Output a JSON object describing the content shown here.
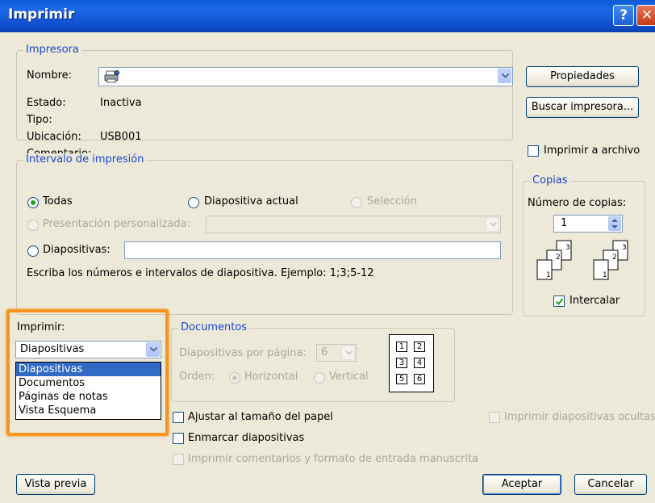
{
  "window": {
    "title": "Imprimir",
    "help_button": "?",
    "close_button": "✕"
  },
  "printer": {
    "legend": "Impresora",
    "name_label": "Nombre:",
    "status_label": "Estado:",
    "status_value": "Inactiva",
    "type_label": "Tipo:",
    "type_value": "",
    "location_label": "Ubicación:",
    "location_value": "USB001",
    "comment_label": "Comentario:",
    "comment_value": "",
    "properties_button": "Propiedades",
    "find_button": "Buscar impresora...",
    "print_to_file_label": "Imprimir a archivo",
    "print_to_file_checked": false
  },
  "range": {
    "legend": "Intervalo de impresión",
    "all_label": "Todas",
    "all_selected": true,
    "current_slide_label": "Diapositiva actual",
    "selection_label": "Selección",
    "custom_show_label": "Presentación personalizada:",
    "slides_label": "Diapositivas:",
    "slides_value": "",
    "hint": "Escriba los números e intervalos de diapositiva. Ejemplo: 1;3;5-12"
  },
  "copies": {
    "legend": "Copias",
    "count_label": "Número de copias:",
    "count_value": "1",
    "collate_label": "Intercalar",
    "collate_checked": true,
    "page_numbers": [
      "1",
      "2",
      "3"
    ]
  },
  "print_what": {
    "label": "Imprimir:",
    "selected": "Diapositivas",
    "options": [
      "Diapositivas",
      "Documentos",
      "Páginas de notas",
      "Vista Esquema"
    ]
  },
  "handouts": {
    "legend": "Documentos",
    "per_page_label": "Diapositivas por página:",
    "per_page_value": "6",
    "order_label": "Orden:",
    "horizontal_label": "Horizontal",
    "vertical_label": "Vertical",
    "preview_numbers": [
      "1",
      "2",
      "3",
      "4",
      "5",
      "6"
    ]
  },
  "options": {
    "scale_label": "Ajustar al tamaño del papel",
    "frame_label": "Enmarcar diapositivas",
    "comments_label": "Imprimir comentarios y formato de entrada manuscrita",
    "hidden_label": "Imprimir diapositivas ocultas"
  },
  "footer": {
    "preview_button": "Vista previa",
    "ok_button": "Aceptar",
    "cancel_button": "Cancelar"
  },
  "colors": {
    "titlebar": "#0f4ecb",
    "legend_text": "#1e45d4",
    "highlight": "#f7931e",
    "selection": "#316ac5"
  }
}
